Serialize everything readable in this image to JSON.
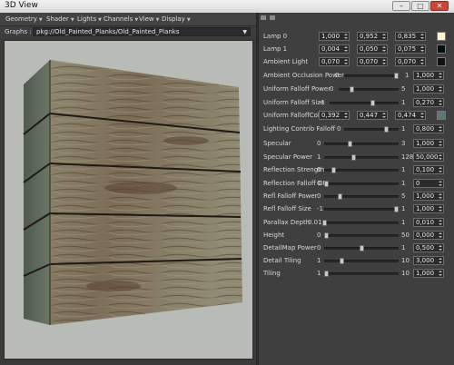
{
  "window": {
    "title": "3D View"
  },
  "menubar": [
    {
      "label": "Geometry"
    },
    {
      "label": "Shader"
    },
    {
      "label": "Lights"
    },
    {
      "label": "Channels"
    },
    {
      "label": "View"
    },
    {
      "label": "Display"
    }
  ],
  "graphs": {
    "label": "Graphs :",
    "path": "pkg://Old_Painted_Planks/Old_Painted_Planks"
  },
  "colors": {
    "wood_light": "#9a8f78",
    "wood_dark": "#4d3b27",
    "paint": "#86917a",
    "viewport_bg": "#b9bcb6"
  },
  "vector_params": [
    {
      "label": "Lamp 0",
      "values": [
        "1,000",
        "0,952",
        "0,835"
      ],
      "swatch": "#fff6d4"
    },
    {
      "label": "Lamp 1",
      "values": [
        "0,004",
        "0,050",
        "0,075"
      ],
      "swatch": "#010d13"
    },
    {
      "label": "Ambient Light",
      "values": [
        "0,070",
        "0,070",
        "0,070"
      ],
      "swatch": "#121212"
    }
  ],
  "slider_params": [
    {
      "label": "Ambient Occlusion Power",
      "min": "0",
      "max": "1",
      "value": "1,000",
      "fraction": 1.0
    },
    {
      "label": "Uniform Falloff Power",
      "min": "0",
      "max": "5",
      "value": "1,000",
      "fraction": 0.2
    },
    {
      "label": "Uniform Falloff Size",
      "min": "-1",
      "max": "1",
      "value": "0,270",
      "fraction": 0.635
    }
  ],
  "falloff_color": {
    "label": "Uniform FalloffColor",
    "values": [
      "0,392",
      "0,447",
      "0,474"
    ],
    "swatch": "#64727a"
  },
  "slider_params2": [
    {
      "label": "Lighting Contrib Falloff",
      "min": "0",
      "max": "1",
      "value": "0,800",
      "fraction": 0.8
    },
    {
      "label": "Specular",
      "min": "0",
      "max": "3",
      "value": "1,000",
      "fraction": 0.333
    },
    {
      "label": "Specular Power",
      "min": "1",
      "max": "128",
      "value": "50,000",
      "fraction": 0.386
    },
    {
      "label": "Reflection Strength",
      "min": "0",
      "max": "1",
      "value": "0,100",
      "fraction": 0.1
    },
    {
      "label": "Reflection Falloff ON",
      "min": "0",
      "max": "1",
      "value": "0",
      "fraction": 0.0
    },
    {
      "label": "Refl Falloff Power",
      "min": "0",
      "max": "5",
      "value": "1,000",
      "fraction": 0.2
    },
    {
      "label": "Refl Falloff Size",
      "min": "-1",
      "max": "1",
      "value": "1,000",
      "fraction": 1.0
    },
    {
      "label": "Parallax Depth",
      "min": "0.01",
      "max": "1",
      "value": "0,010",
      "fraction": 0.0
    },
    {
      "label": "Height",
      "min": "0",
      "max": "50",
      "value": "0,000",
      "fraction": 0.0
    },
    {
      "label": "DetailMap Power",
      "min": "0",
      "max": "1",
      "value": "0,500",
      "fraction": 0.5
    },
    {
      "label": "Detail Tiling",
      "min": "1",
      "max": "10",
      "value": "3,000",
      "fraction": 0.222
    },
    {
      "label": "Tiling",
      "min": "1",
      "max": "10",
      "value": "1,000",
      "fraction": 0.0
    }
  ]
}
